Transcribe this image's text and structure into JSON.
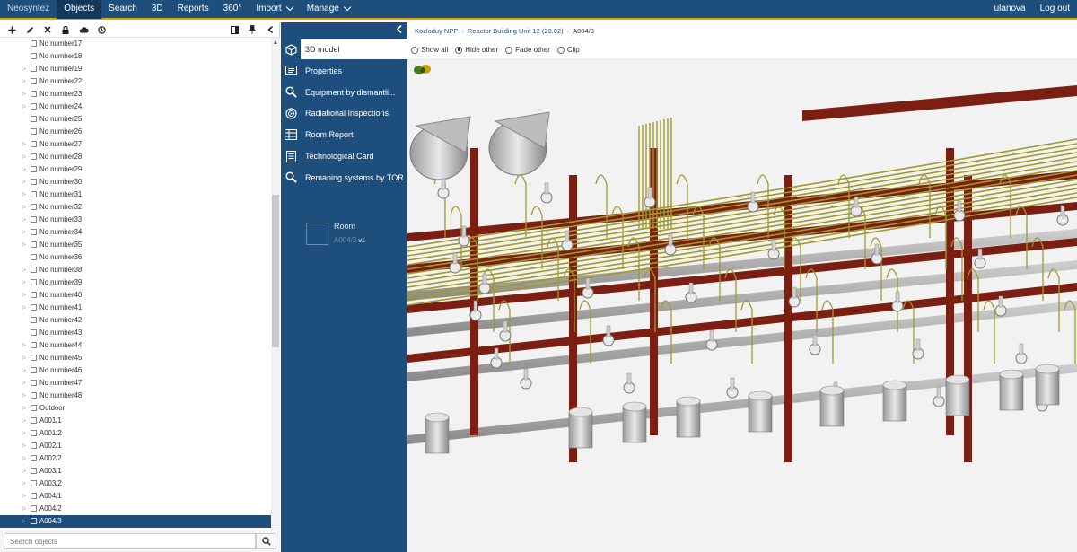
{
  "nav": {
    "brand": "Neosyntez",
    "items": [
      "Objects",
      "Search",
      "3D",
      "Reports",
      "360°",
      "Import",
      "Manage"
    ],
    "user": "ulanova",
    "logout": "Log out"
  },
  "tree": {
    "rows": [
      {
        "label": "No number17",
        "arrow": false
      },
      {
        "label": "No number18",
        "arrow": false
      },
      {
        "label": "No number19",
        "arrow": true
      },
      {
        "label": "No number22",
        "arrow": true
      },
      {
        "label": "No number23",
        "arrow": true
      },
      {
        "label": "No number24",
        "arrow": true
      },
      {
        "label": "No number25",
        "arrow": false
      },
      {
        "label": "No number26",
        "arrow": false
      },
      {
        "label": "No number27",
        "arrow": true
      },
      {
        "label": "No number28",
        "arrow": true
      },
      {
        "label": "No number29",
        "arrow": true
      },
      {
        "label": "No number30",
        "arrow": true
      },
      {
        "label": "No number31",
        "arrow": true
      },
      {
        "label": "No number32",
        "arrow": true
      },
      {
        "label": "No number33",
        "arrow": true
      },
      {
        "label": "No number34",
        "arrow": true
      },
      {
        "label": "No number35",
        "arrow": true
      },
      {
        "label": "No number36",
        "arrow": false
      },
      {
        "label": "No number38",
        "arrow": true
      },
      {
        "label": "No number39",
        "arrow": true
      },
      {
        "label": "No number40",
        "arrow": true
      },
      {
        "label": "No number41",
        "arrow": true
      },
      {
        "label": "No number42",
        "arrow": false
      },
      {
        "label": "No number43",
        "arrow": false
      },
      {
        "label": "No number44",
        "arrow": true
      },
      {
        "label": "No number45",
        "arrow": true
      },
      {
        "label": "No number46",
        "arrow": true
      },
      {
        "label": "No number47",
        "arrow": true
      },
      {
        "label": "No number48",
        "arrow": true
      },
      {
        "label": "Outdoor",
        "arrow": true
      },
      {
        "label": "A001/1",
        "arrow": true
      },
      {
        "label": "A001/2",
        "arrow": true
      },
      {
        "label": "A002/1",
        "arrow": true
      },
      {
        "label": "A002/2",
        "arrow": true
      },
      {
        "label": "A003/1",
        "arrow": true
      },
      {
        "label": "A003/2",
        "arrow": true
      },
      {
        "label": "A004/1",
        "arrow": true
      },
      {
        "label": "A004/2",
        "arrow": true
      },
      {
        "label": "A004/3",
        "arrow": true,
        "selected": true
      }
    ],
    "search_placeholder": "Search objects"
  },
  "menu": {
    "items": [
      {
        "label": "3D model",
        "icon": "cube-icon",
        "active": true
      },
      {
        "label": "Properties",
        "icon": "properties-icon"
      },
      {
        "label": "Equipment by dismantli...",
        "icon": "search-icon"
      },
      {
        "label": "Radiational Inspections",
        "icon": "radiation-icon"
      },
      {
        "label": "Room Report",
        "icon": "report-icon"
      },
      {
        "label": "Technological Card",
        "icon": "card-icon"
      },
      {
        "label": "Remaning systems by TOR",
        "icon": "search-icon"
      }
    ],
    "room": {
      "title": "Room",
      "name": "A004/3",
      "version": "v1"
    }
  },
  "viewer": {
    "breadcrumb": [
      "Kozloduy NPP",
      "Reactor Building Unit 12 (20.02)",
      "A004/3"
    ],
    "options": [
      {
        "label": "Show all",
        "selected": false
      },
      {
        "label": "Hide other",
        "selected": true
      },
      {
        "label": "Fade other",
        "selected": false
      },
      {
        "label": "Clip",
        "selected": false
      }
    ]
  },
  "colors": {
    "nav_bg": "#1e4f7c",
    "accent": "#e8a300",
    "beam_red": "#7a1f12",
    "pipe_olive": "#a09a2a"
  }
}
